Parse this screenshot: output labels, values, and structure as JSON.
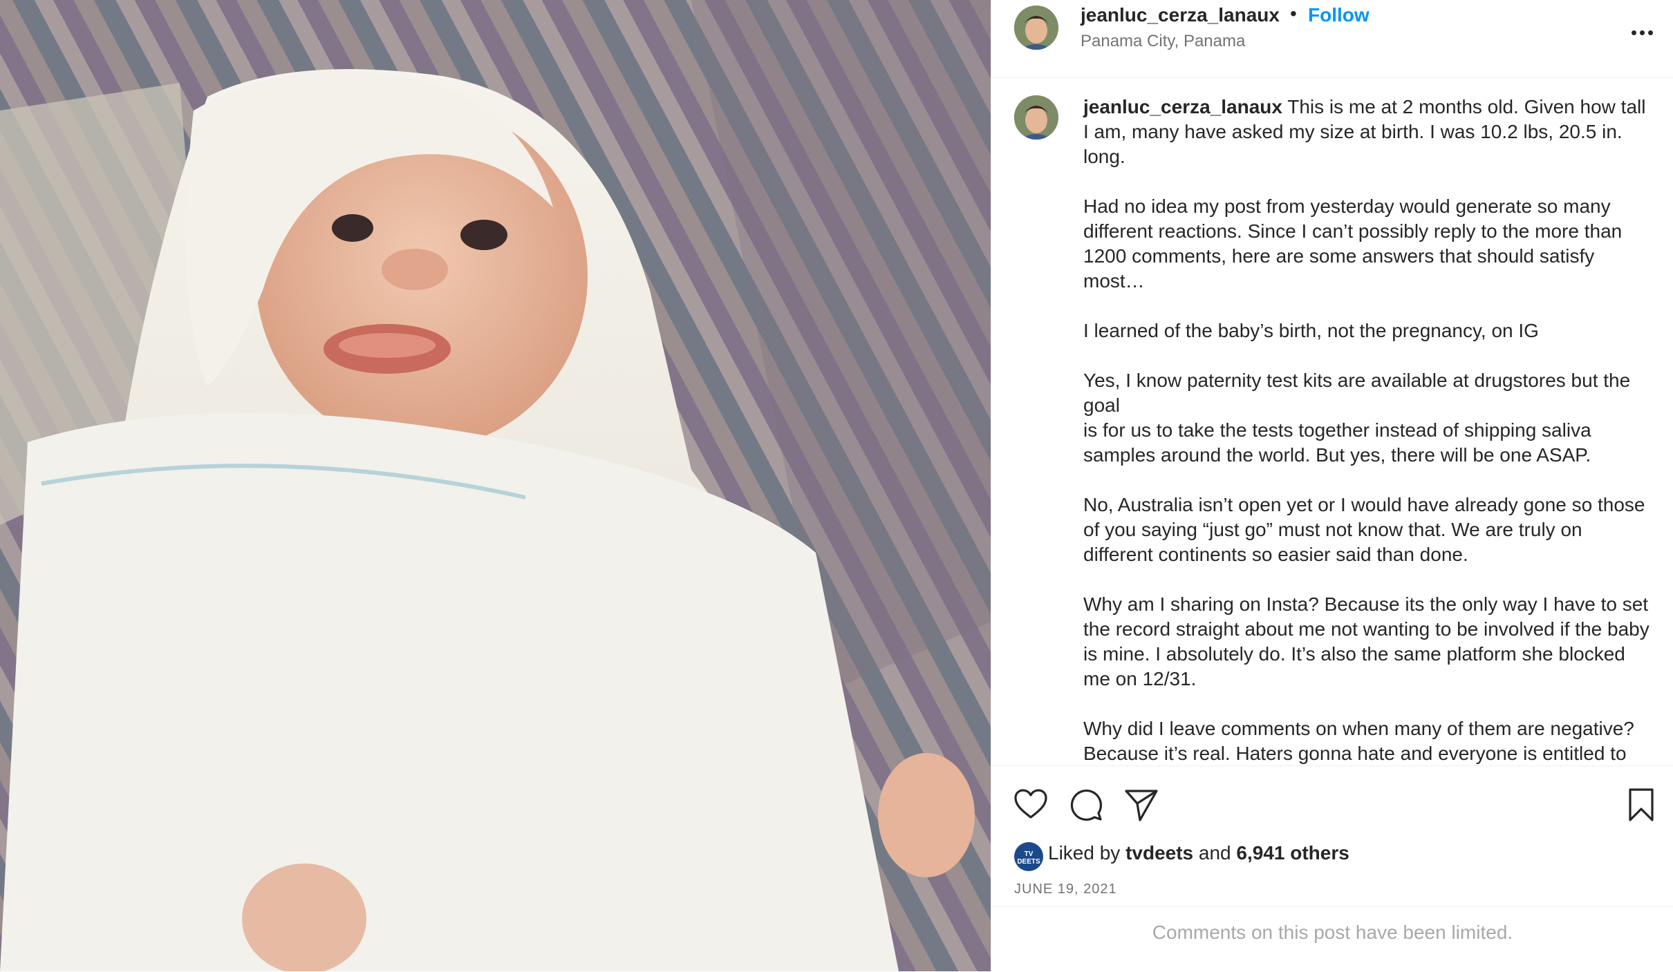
{
  "header": {
    "username": "jeanluc_cerza_lanaux",
    "separator": "•",
    "follow_label": "Follow",
    "location": "Panama City, Panama"
  },
  "caption": {
    "username": "jeanluc_cerza_lanaux",
    "first_line": "This is me at 2 months old. Given how tall I am, many have asked my size at birth. I was 10.2 lbs, 20.5 in. long.",
    "paragraphs": [
      "Had no idea my post from yesterday would generate so many different reactions. Since I can’t possibly reply to the more than 1200 comments, here are some answers that should satisfy most…",
      "I learned of the baby’s birth, not the pregnancy, on IG",
      "Yes, I know paternity test kits are available at drugstores but the goal\nis for us to take the tests together instead of shipping saliva samples around the world. But yes, there will be one ASAP.",
      "No, Australia isn’t open yet or I would have already gone so those of you saying “just go” must not know that. We are truly on different continents so easier said than done.",
      "Why am I sharing on Insta? Because its the only way I have to set the record straight about me not wanting to be involved if the baby is mine. I absolutely do. It’s also the same platform she blocked me on 12/31.",
      "Why did I leave comments on when many of them are negative? Because it’s real. Haters gonna hate and everyone is entitled to"
    ]
  },
  "actions": {
    "icons": [
      "heart-icon",
      "comment-icon",
      "share-icon",
      "bookmark-icon"
    ]
  },
  "likes": {
    "prefix": "Liked by",
    "user": "tvdeets",
    "middle": "and",
    "others": "6,941 others",
    "avatar_text": "TV DEETS"
  },
  "date": "JUNE 19, 2021",
  "comments_limited": "Comments on this post have been limited.",
  "colors": {
    "accent": "#0095f6",
    "text": "#262626",
    "secondary": "#737373",
    "muted": "#a8a8a8",
    "border": "#efefef"
  }
}
